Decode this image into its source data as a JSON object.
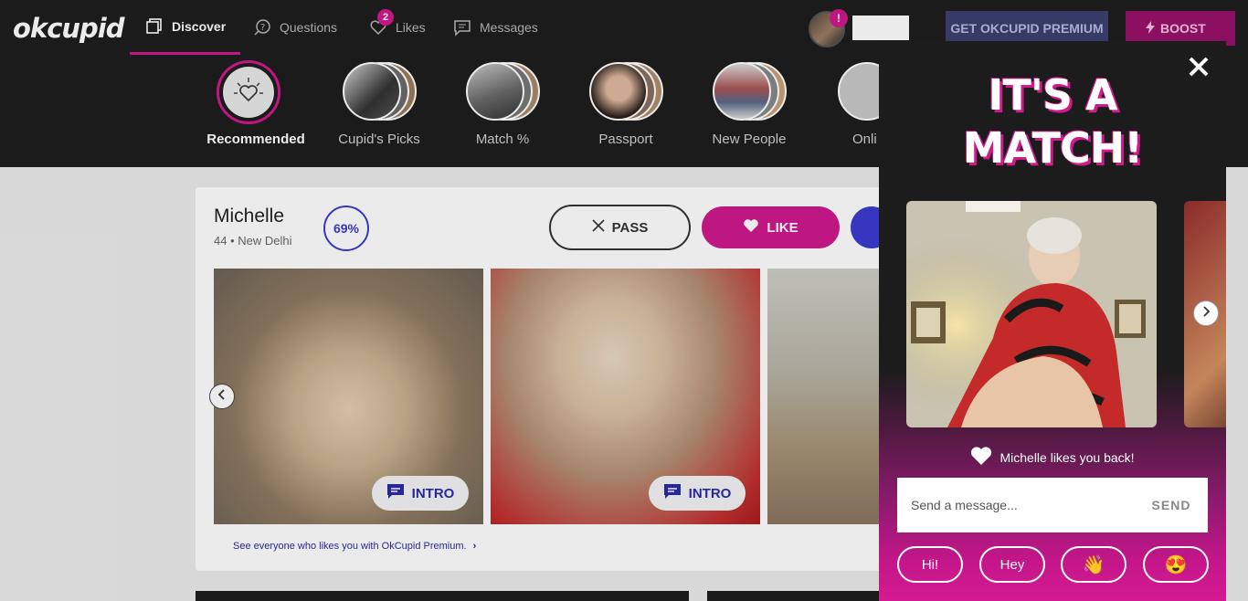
{
  "header": {
    "logo": "okcupid",
    "nav": [
      {
        "label": "Discover",
        "icon": "discover-icon"
      },
      {
        "label": "Questions",
        "icon": "questions-icon"
      },
      {
        "label": "Likes",
        "icon": "likes-heart-icon",
        "badge": "2"
      },
      {
        "label": "Messages",
        "icon": "messages-icon"
      }
    ],
    "profile_badge": "!",
    "premium_label": "GET OKCUPID PREMIUM",
    "boost_label": "BOOST"
  },
  "categories": [
    {
      "label": "Recommended"
    },
    {
      "label": "Cupid's Picks"
    },
    {
      "label": "Match %"
    },
    {
      "label": "Passport"
    },
    {
      "label": "New People"
    },
    {
      "label": "Onli"
    }
  ],
  "profile": {
    "name": "Michelle",
    "meta": "44 • New Delhi",
    "match": "69%",
    "pass_label": "PASS",
    "like_label": "LIKE",
    "intro_label": "INTRO",
    "see_link": "See everyone who likes you with OkCupid Premium."
  },
  "modal": {
    "title_line1": "IT'S A",
    "title_line2": "MATCH!",
    "likes_back": "Michelle likes you back!",
    "message_placeholder": "Send a message...",
    "send_label": "SEND",
    "quick_replies": [
      "Hi!",
      "Hey",
      "👋",
      "😍"
    ]
  },
  "colors": {
    "accent": "#d01a8c",
    "blue": "#3b3bd1",
    "dark": "#1e1e1e"
  }
}
